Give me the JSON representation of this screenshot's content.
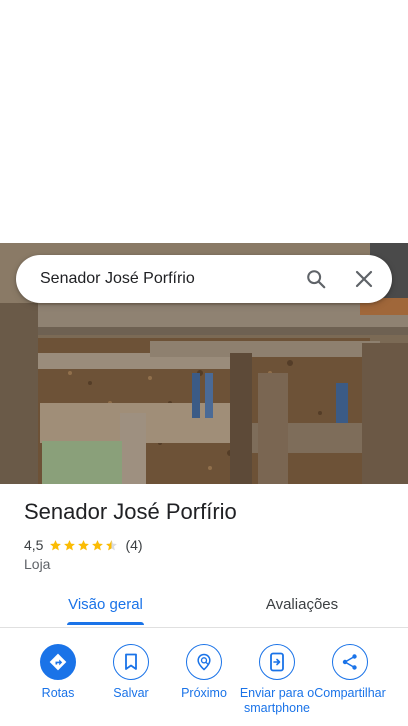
{
  "search": {
    "query": "Senador José Porfírio"
  },
  "place": {
    "title": "Senador José Porfírio",
    "rating": "4,5",
    "rating_value": 4.5,
    "review_count": "(4)",
    "category": "Loja"
  },
  "tabs": [
    {
      "label": "Visão geral",
      "active": true
    },
    {
      "label": "Avaliações",
      "active": false
    }
  ],
  "actions": [
    {
      "label": "Rotas",
      "icon": "directions-icon"
    },
    {
      "label": "Salvar",
      "icon": "bookmark-icon"
    },
    {
      "label": "Próximo",
      "icon": "nearby-icon"
    },
    {
      "label": "Enviar para o smartphone",
      "icon": "send-to-phone-icon"
    },
    {
      "label": "Compartilhar",
      "icon": "share-icon"
    }
  ],
  "colors": {
    "accent": "#1a73e8",
    "star": "#fbbc04"
  }
}
